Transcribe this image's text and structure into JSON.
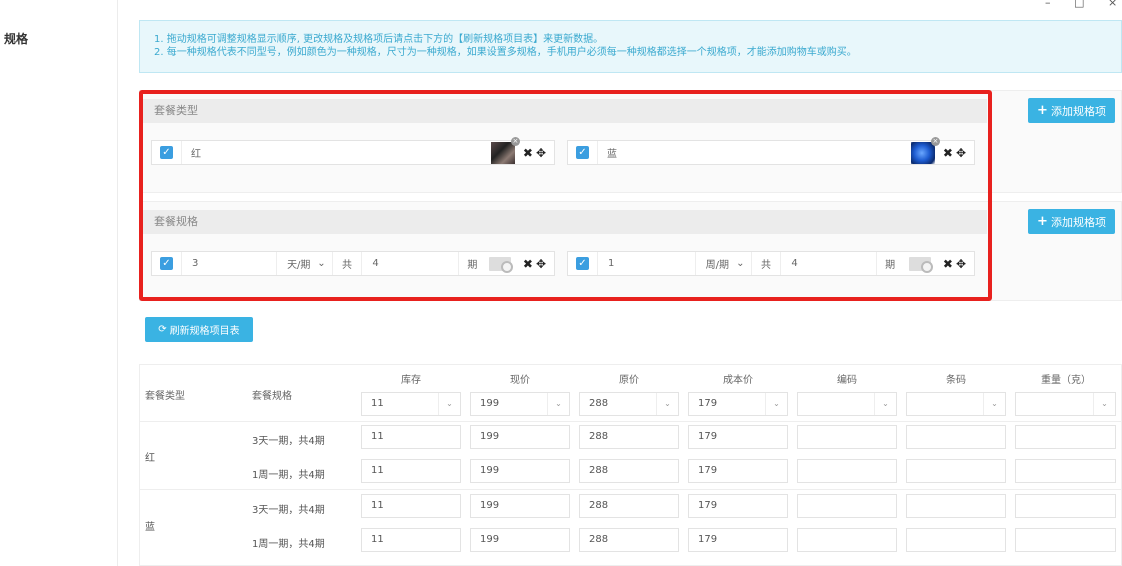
{
  "window_controls": {
    "minimize": "–",
    "maximize": "□",
    "close": "×"
  },
  "left_label": "规格",
  "notice": {
    "line1": "1. 拖动规格可调整规格显示顺序, 更改规格及规格项后请点击下方的【刷新规格项目表】来更新数据。",
    "line2": "2. 每一种规格代表不同型号，例如颜色为一种规格，尺寸为一种规格，如果设置多规格，手机用户必须每一种规格都选择一个规格项，才能添加购物车或购买。"
  },
  "groups": [
    {
      "title": "套餐类型",
      "add_label": "添加规格项",
      "items": [
        {
          "value": "红",
          "checked": true,
          "thumb": "photo-thumbnail-dark"
        },
        {
          "value": "蓝",
          "checked": true,
          "thumb": "photo-thumbnail-blue-rose"
        }
      ]
    },
    {
      "title": "套餐规格",
      "add_label": "添加规格项",
      "items": [
        {
          "value": "3",
          "unit": "天/期",
          "gong": "共",
          "count": "4",
          "qi": "期",
          "checked": true
        },
        {
          "value": "1",
          "unit": "周/期",
          "gong": "共",
          "count": "4",
          "qi": "期",
          "checked": true
        }
      ]
    }
  ],
  "refresh_label": "刷新规格项目表",
  "table": {
    "headers": [
      "套餐类型",
      "套餐规格",
      "库存",
      "现价",
      "原价",
      "成本价",
      "编码",
      "条码",
      "重量（克）"
    ],
    "batch": [
      "11",
      "199",
      "288",
      "179",
      "",
      "",
      ""
    ],
    "groups": [
      {
        "type": "红",
        "rows": [
          {
            "spec": "3天一期，共4期",
            "values": [
              "11",
              "199",
              "288",
              "179",
              "",
              "",
              ""
            ]
          },
          {
            "spec": "1周一期，共4期",
            "values": [
              "11",
              "199",
              "288",
              "179",
              "",
              "",
              ""
            ]
          }
        ]
      },
      {
        "type": "蓝",
        "rows": [
          {
            "spec": "3天一期，共4期",
            "values": [
              "11",
              "199",
              "288",
              "179",
              "",
              "",
              ""
            ]
          },
          {
            "spec": "1周一期，共4期",
            "values": [
              "11",
              "199",
              "288",
              "179",
              "",
              "",
              ""
            ]
          }
        ]
      }
    ]
  },
  "colors": {
    "accent": "#3ab3e3",
    "checkbox": "#3b9ee0",
    "highlight_frame": "#e8211e",
    "notice_bg": "#e8f7fb"
  }
}
